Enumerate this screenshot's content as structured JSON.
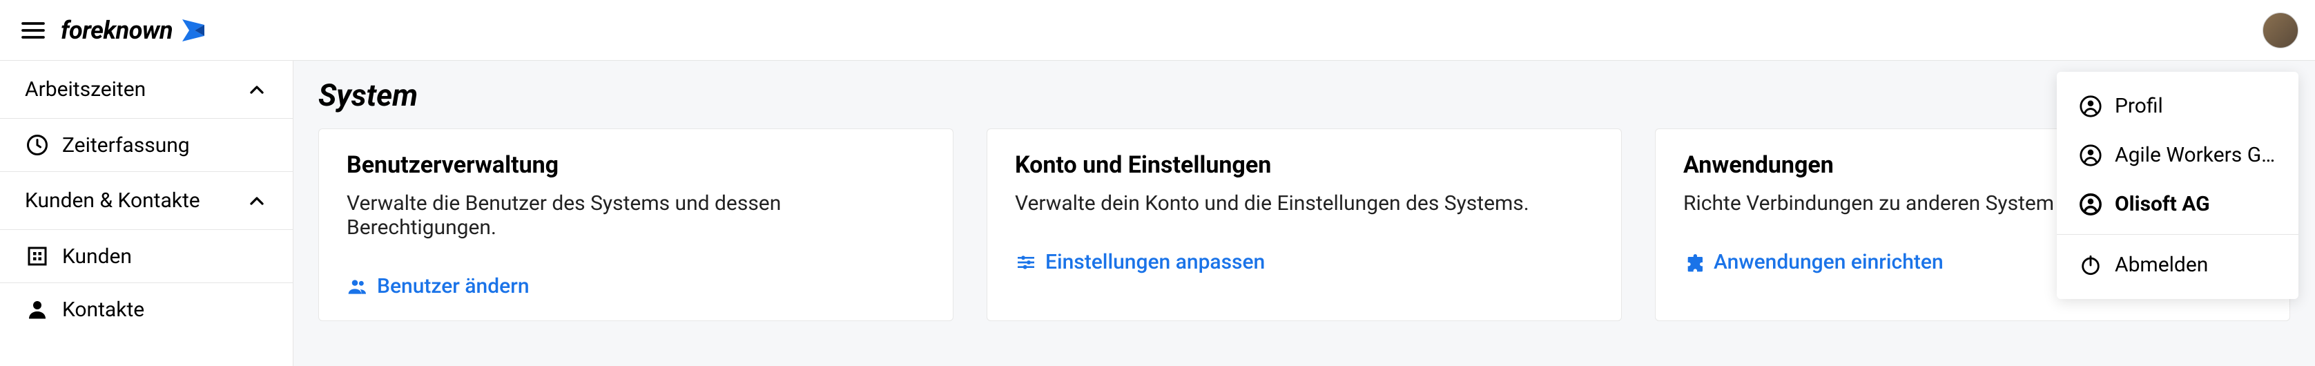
{
  "brand": "foreknown",
  "sidebar": {
    "groups": [
      {
        "label": "Arbeitszeiten",
        "items": [
          {
            "label": "Zeiterfassung",
            "icon": "clock-icon"
          }
        ]
      },
      {
        "label": "Kunden & Kontakte",
        "items": [
          {
            "label": "Kunden",
            "icon": "building-icon"
          },
          {
            "label": "Kontakte",
            "icon": "person-icon"
          }
        ]
      }
    ]
  },
  "page": {
    "title": "System",
    "cards": [
      {
        "title": "Benutzerverwaltung",
        "body": "Verwalte die Benutzer des Systems und dessen Berechtigungen.",
        "link_label": "Benutzer ändern",
        "link_icon": "people-icon"
      },
      {
        "title": "Konto und Einstellungen",
        "body": "Verwalte dein Konto und die Einstellungen des Systems.",
        "link_label": "Einstellungen anpassen",
        "link_icon": "tune-icon"
      },
      {
        "title": "Anwendungen",
        "body": "Richte Verbindungen zu anderen System",
        "link_label": "Anwendungen einrichten",
        "link_icon": "puzzle-icon"
      }
    ]
  },
  "user_menu": {
    "items": [
      {
        "label": "Profil",
        "icon": "account-icon"
      },
      {
        "label": "Agile Workers Gm...",
        "icon": "account-icon"
      },
      {
        "label": "Olisoft AG",
        "icon": "account-icon",
        "bold": true
      },
      {
        "label": "Abmelden",
        "icon": "power-icon",
        "separator": true
      }
    ]
  }
}
